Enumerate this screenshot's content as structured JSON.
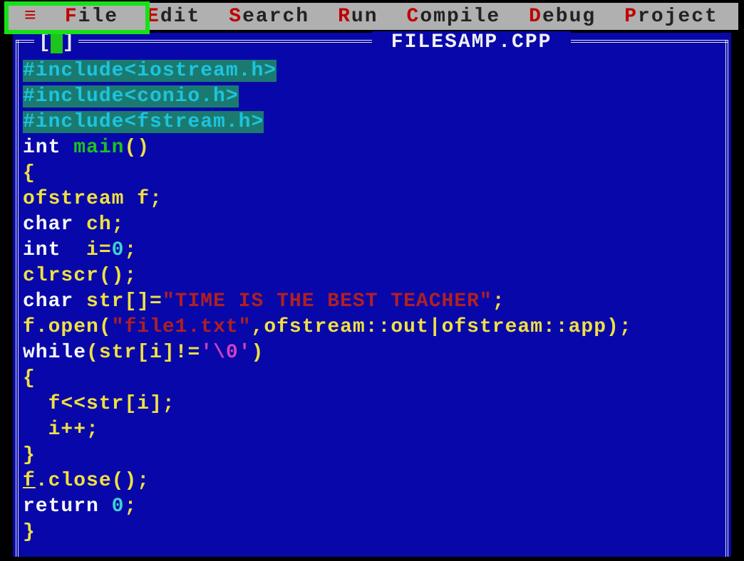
{
  "menubar": {
    "hamburger": "≡",
    "items": [
      {
        "hot": "F",
        "rest": "ile"
      },
      {
        "hot": "E",
        "rest": "dit"
      },
      {
        "hot": "S",
        "rest": "earch"
      },
      {
        "hot": "R",
        "rest": "un"
      },
      {
        "hot": "C",
        "rest": "ompile"
      },
      {
        "hot": "D",
        "rest": "ebug"
      },
      {
        "hot": "P",
        "rest": "roject"
      }
    ]
  },
  "window": {
    "title": " FILESAMP.CPP ",
    "close_left": "[",
    "close_mid": "■",
    "close_right": "]"
  },
  "code": {
    "lines": [
      {
        "selected": true,
        "segments": [
          {
            "cls": "c-pre",
            "t": "#include<iostream.h>"
          }
        ]
      },
      {
        "selected": true,
        "segments": [
          {
            "cls": "c-pre",
            "t": "#include<conio.h>"
          }
        ]
      },
      {
        "selected": true,
        "segments": [
          {
            "cls": "c-pre",
            "t": "#include<fstream.h>"
          }
        ]
      },
      {
        "segments": [
          {
            "cls": "c-kw",
            "t": "int "
          },
          {
            "cls": "c-func",
            "t": "main"
          },
          {
            "cls": "c-punct",
            "t": "()"
          }
        ]
      },
      {
        "segments": [
          {
            "cls": "c-punct",
            "t": "{"
          }
        ]
      },
      {
        "segments": [
          {
            "cls": "c-ident",
            "t": "ofstream f"
          },
          {
            "cls": "c-punct",
            "t": ";"
          }
        ]
      },
      {
        "segments": [
          {
            "cls": "c-kw",
            "t": "char "
          },
          {
            "cls": "c-ident",
            "t": "ch"
          },
          {
            "cls": "c-punct",
            "t": ";"
          }
        ]
      },
      {
        "segments": [
          {
            "cls": "c-kw",
            "t": "int  "
          },
          {
            "cls": "c-ident",
            "t": "i"
          },
          {
            "cls": "c-punct",
            "t": "="
          },
          {
            "cls": "c-num",
            "t": "0"
          },
          {
            "cls": "c-punct",
            "t": ";"
          }
        ]
      },
      {
        "segments": [
          {
            "cls": "c-ident",
            "t": "clrscr"
          },
          {
            "cls": "c-punct",
            "t": "();"
          }
        ]
      },
      {
        "segments": [
          {
            "cls": "c-kw",
            "t": "char "
          },
          {
            "cls": "c-ident",
            "t": "str"
          },
          {
            "cls": "c-punct",
            "t": "[]="
          },
          {
            "cls": "c-str",
            "t": "\"TIME IS THE BEST TEACHER\""
          },
          {
            "cls": "c-punct",
            "t": ";"
          }
        ]
      },
      {
        "segments": [
          {
            "cls": "c-ident",
            "t": "f"
          },
          {
            "cls": "c-punct",
            "t": "."
          },
          {
            "cls": "c-ident",
            "t": "open"
          },
          {
            "cls": "c-punct",
            "t": "("
          },
          {
            "cls": "c-str",
            "t": "\"file1.txt\""
          },
          {
            "cls": "c-punct",
            "t": ","
          },
          {
            "cls": "c-ident",
            "t": "ofstream"
          },
          {
            "cls": "c-punct",
            "t": "::"
          },
          {
            "cls": "c-ident",
            "t": "out"
          },
          {
            "cls": "c-punct",
            "t": "|"
          },
          {
            "cls": "c-ident",
            "t": "ofstream"
          },
          {
            "cls": "c-punct",
            "t": "::"
          },
          {
            "cls": "c-ident",
            "t": "app"
          },
          {
            "cls": "c-punct",
            "t": ");"
          }
        ]
      },
      {
        "segments": [
          {
            "cls": "c-kw",
            "t": "while"
          },
          {
            "cls": "c-punct",
            "t": "("
          },
          {
            "cls": "c-ident",
            "t": "str"
          },
          {
            "cls": "c-punct",
            "t": "["
          },
          {
            "cls": "c-ident",
            "t": "i"
          },
          {
            "cls": "c-punct",
            "t": "]!="
          },
          {
            "cls": "c-char",
            "t": "'\\0'"
          },
          {
            "cls": "c-punct",
            "t": ")"
          }
        ]
      },
      {
        "segments": [
          {
            "cls": "c-punct",
            "t": "{"
          }
        ]
      },
      {
        "segments": [
          {
            "cls": "c-ident",
            "t": "  f"
          },
          {
            "cls": "c-punct",
            "t": "<<"
          },
          {
            "cls": "c-ident",
            "t": "str"
          },
          {
            "cls": "c-punct",
            "t": "["
          },
          {
            "cls": "c-ident",
            "t": "i"
          },
          {
            "cls": "c-punct",
            "t": "];"
          }
        ]
      },
      {
        "segments": [
          {
            "cls": "c-ident",
            "t": "  i"
          },
          {
            "cls": "c-punct",
            "t": "++;"
          }
        ]
      },
      {
        "segments": [
          {
            "cls": "c-punct",
            "t": "}"
          }
        ]
      },
      {
        "segments": [
          {
            "cls": "c-ident c-under",
            "t": "f"
          },
          {
            "cls": "c-punct",
            "t": "."
          },
          {
            "cls": "c-ident",
            "t": "close"
          },
          {
            "cls": "c-punct",
            "t": "();"
          }
        ]
      },
      {
        "segments": [
          {
            "cls": "c-kw",
            "t": "return "
          },
          {
            "cls": "c-num",
            "t": "0"
          },
          {
            "cls": "c-punct",
            "t": ";"
          }
        ]
      },
      {
        "segments": [
          {
            "cls": "c-punct",
            "t": "}"
          }
        ]
      }
    ]
  }
}
